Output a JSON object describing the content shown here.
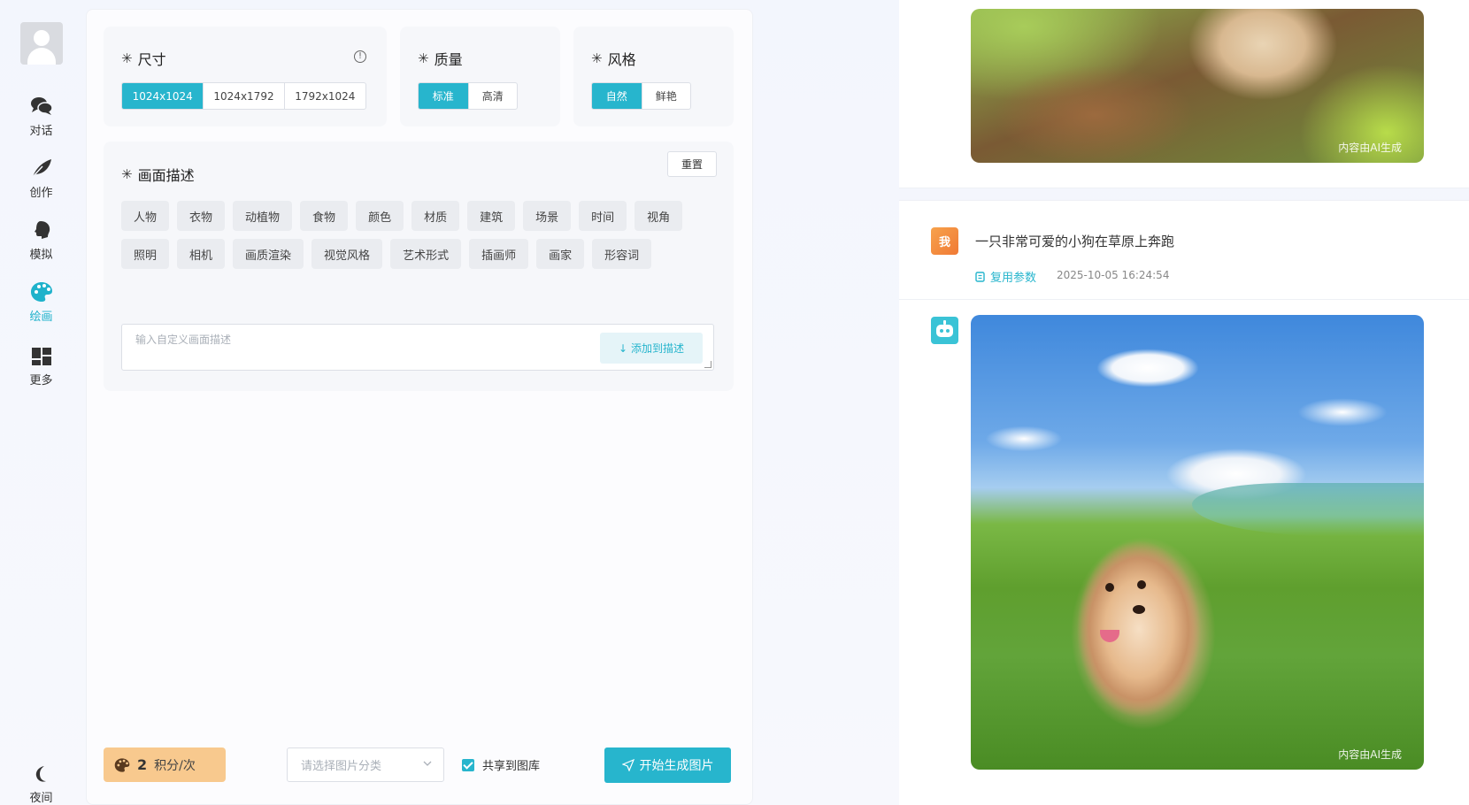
{
  "sidebar": {
    "items": [
      {
        "label": "对话",
        "icon": "chat-icon"
      },
      {
        "label": "创作",
        "icon": "feather-icon"
      },
      {
        "label": "模拟",
        "icon": "head-icon"
      },
      {
        "label": "绘画",
        "icon": "palette-icon",
        "active": true
      },
      {
        "label": "更多",
        "icon": "grid-icon"
      }
    ],
    "bottom_label": "夜间",
    "bottom_icon": "moon-icon"
  },
  "size_section": {
    "title": "尺寸",
    "info_icon": "info-icon",
    "options": [
      "1024x1024",
      "1024x1792",
      "1792x1024"
    ],
    "selected": "1024x1024"
  },
  "quality_section": {
    "title": "质量",
    "options": [
      "标准",
      "高清"
    ],
    "selected": "标准"
  },
  "style_section": {
    "title": "风格",
    "options": [
      "自然",
      "鲜艳"
    ],
    "selected": "自然"
  },
  "description_section": {
    "title": "画面描述",
    "reset_label": "重置",
    "tags": [
      "人物",
      "衣物",
      "动植物",
      "食物",
      "颜色",
      "材质",
      "建筑",
      "场景",
      "时间",
      "视角",
      "照明",
      "相机",
      "画质渲染",
      "视觉风格",
      "艺术形式",
      "插画师",
      "画家",
      "形容词"
    ],
    "custom_placeholder": "输入自定义画面描述",
    "add_label": "添加到描述"
  },
  "footer": {
    "points_value": "2",
    "points_unit": "积分/次",
    "category_placeholder": "请选择图片分类",
    "share_label": "共享到图库",
    "share_checked": true,
    "generate_label": "开始生成图片"
  },
  "chat": {
    "watermark": "内容由AI生成",
    "user_avatar_label": "我",
    "prompt": "一只非常可爱的小狗在草原上奔跑",
    "reuse_label": "复用参数",
    "timestamp": "2025-10-05 16:24:54"
  },
  "colors": {
    "accent": "#27b5cd",
    "points_badge": "#f8c98e",
    "user_avatar": "#f28a3c",
    "bot_avatar": "#3ac3d6"
  }
}
